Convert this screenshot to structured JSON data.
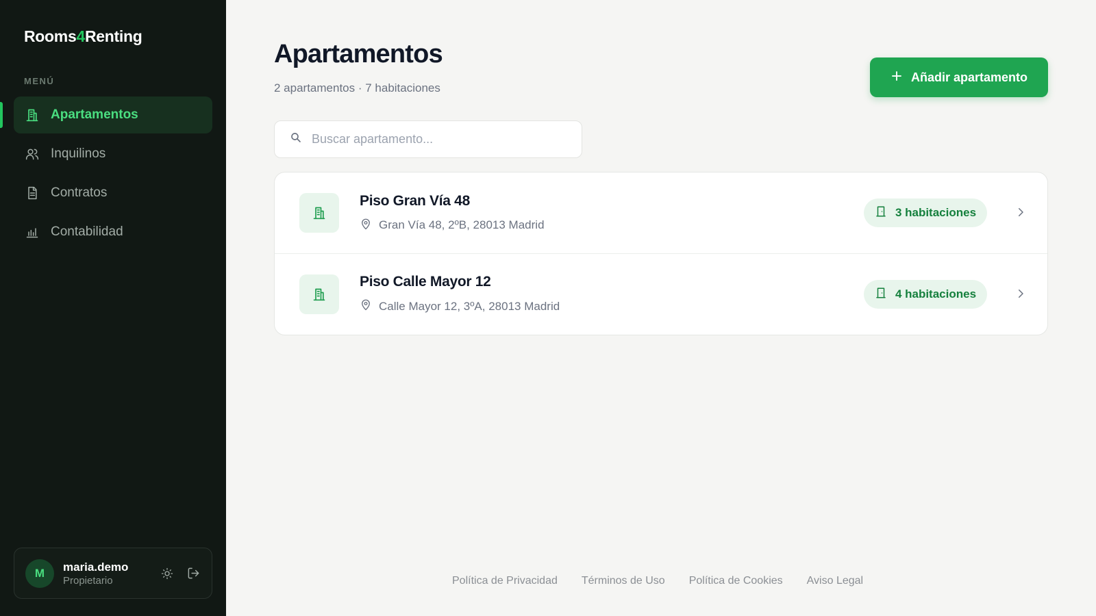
{
  "app": {
    "brand_prefix": "Rooms",
    "brand_accent": "4",
    "brand_suffix": "Renting",
    "accent_color": "#22c55e",
    "sidebar_bg": "#111814"
  },
  "sidebar": {
    "menu_label": "MENÚ",
    "items": [
      {
        "label": "Apartamentos",
        "icon": "building-icon",
        "active": true
      },
      {
        "label": "Inquilinos",
        "icon": "users-icon",
        "active": false
      },
      {
        "label": "Contratos",
        "icon": "document-icon",
        "active": false
      },
      {
        "label": "Contabilidad",
        "icon": "bar-chart-icon",
        "active": false
      }
    ],
    "user": {
      "initial": "M",
      "name": "maria.demo",
      "role": "Propietario",
      "actions": [
        "sun-icon",
        "logout-icon"
      ]
    }
  },
  "main": {
    "title": "Apartamentos",
    "subtitle": "2 apartamentos · 7 habitaciones",
    "add_button": "Añadir apartamento",
    "search_placeholder": "Buscar apartamento...",
    "apartments": [
      {
        "name": "Piso Gran Vía 48",
        "address": "Gran Vía 48, 2ºB, 28013 Madrid",
        "rooms": "3 habitaciones"
      },
      {
        "name": "Piso Calle Mayor 12",
        "address": "Calle Mayor 12, 3ºA, 28013 Madrid",
        "rooms": "4 habitaciones"
      }
    ]
  },
  "footer": {
    "links": [
      "Política de Privacidad",
      "Términos de Uso",
      "Política de Cookies",
      "Aviso Legal"
    ]
  }
}
